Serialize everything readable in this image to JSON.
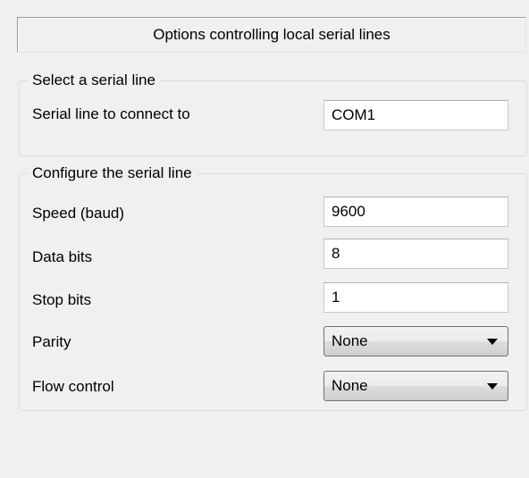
{
  "header": {
    "title": "Options controlling local serial lines"
  },
  "select_group": {
    "legend": "Select a serial line",
    "line_label": "Serial line to connect to",
    "line_value": "COM1"
  },
  "config_group": {
    "legend": "Configure the serial line",
    "speed_label": "Speed (baud)",
    "speed_value": "9600",
    "databits_label": "Data bits",
    "databits_value": "8",
    "stopbits_label": "Stop bits",
    "stopbits_value": "1",
    "parity_label": "Parity",
    "parity_value": "None",
    "flow_label": "Flow control",
    "flow_value": "None"
  },
  "icons": {
    "dropdown": "chevron-down-icon"
  }
}
